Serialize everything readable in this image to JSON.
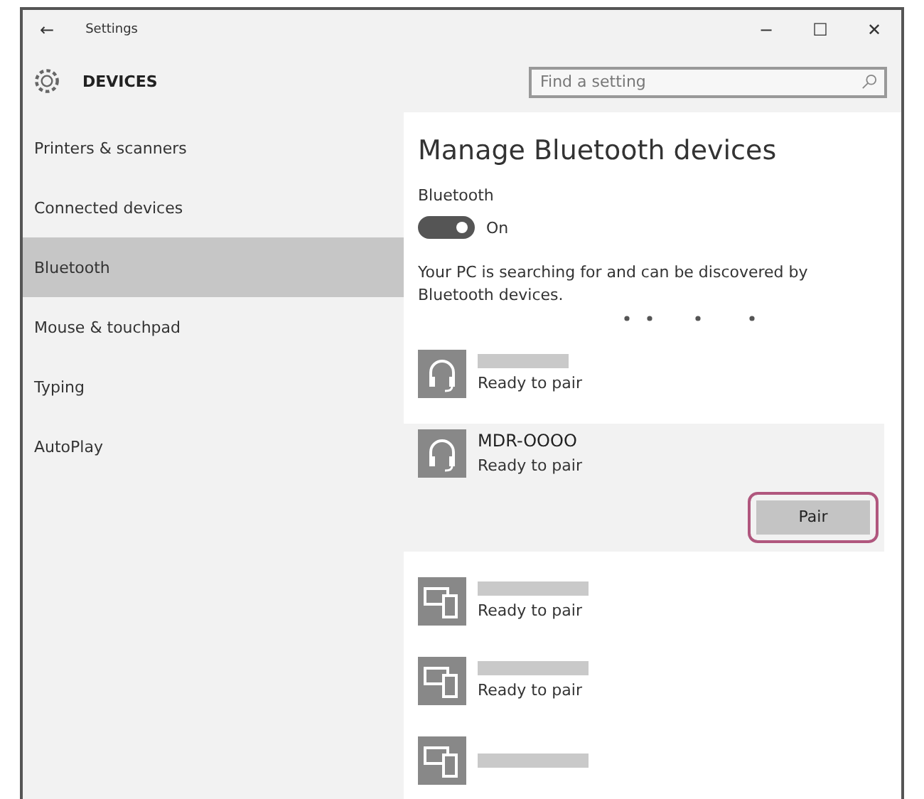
{
  "window": {
    "title": "Settings",
    "back": "←",
    "controls": [
      "−",
      "☐",
      "✕"
    ]
  },
  "header": {
    "title": "DEVICES",
    "search": {
      "placeholder": "Find a setting"
    }
  },
  "sidebar": {
    "items": [
      {
        "label": "Printers & scanners",
        "selected": false
      },
      {
        "label": "Connected devices",
        "selected": false
      },
      {
        "label": "Bluetooth",
        "selected": true
      },
      {
        "label": "Mouse & touchpad",
        "selected": false
      },
      {
        "label": "Typing",
        "selected": false
      },
      {
        "label": "AutoPlay",
        "selected": false
      }
    ]
  },
  "content": {
    "heading": "Manage Bluetooth devices",
    "toggle_label": "Bluetooth",
    "toggle": {
      "on": true,
      "label": "On"
    },
    "description": "Your PC is searching for and can be discovered by Bluetooth devices.",
    "devices": [
      {
        "kind": "headphones",
        "status": "Ready to pair",
        "selected": false
      },
      {
        "kind": "headphones",
        "name": "MDR-OOOO",
        "status": "Ready to pair",
        "selected": true,
        "button": {
          "label": "Pair",
          "highlighted": true
        }
      },
      {
        "kind": "phone",
        "status": "Ready to pair",
        "selected": false
      },
      {
        "kind": "phone",
        "status": "Ready to pair",
        "selected": false
      },
      {
        "kind": "phone",
        "selected": false
      }
    ]
  }
}
